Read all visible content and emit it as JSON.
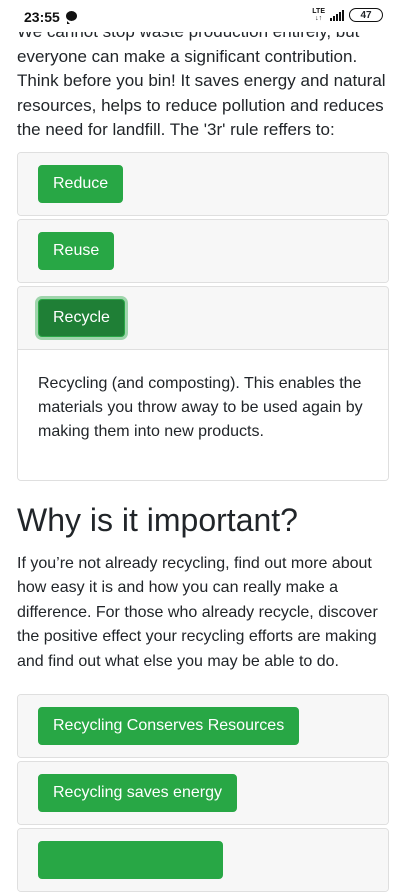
{
  "status_bar": {
    "time": "23:55",
    "network": "LTE",
    "battery": "47"
  },
  "intro": "We cannot stop waste production entirely, but everyone can make a significant contribution. Think before you bin! It saves energy and natural resources, helps to reduce pollution and reduces the need for landfill. The '3r' rule reffers to:",
  "rules": {
    "reduce": "Reduce",
    "reuse": "Reuse",
    "recycle": "Recycle",
    "recycle_body": "Recycling (and composting). This enables the materials you throw away to be used again by making them into new products."
  },
  "why": {
    "heading": "Why is it important?",
    "text": "If you’re not already recycling, find out more about how easy it is and how you can really make a difference. For those who already recycle, discover the positive effect your recycling efforts are making and find out what else you may be able to do.",
    "items": [
      "Recycling Conserves Resources",
      "Recycling saves energy",
      ""
    ]
  },
  "colors": {
    "accent": "#28a745",
    "accent_active": "#1f7f36"
  }
}
